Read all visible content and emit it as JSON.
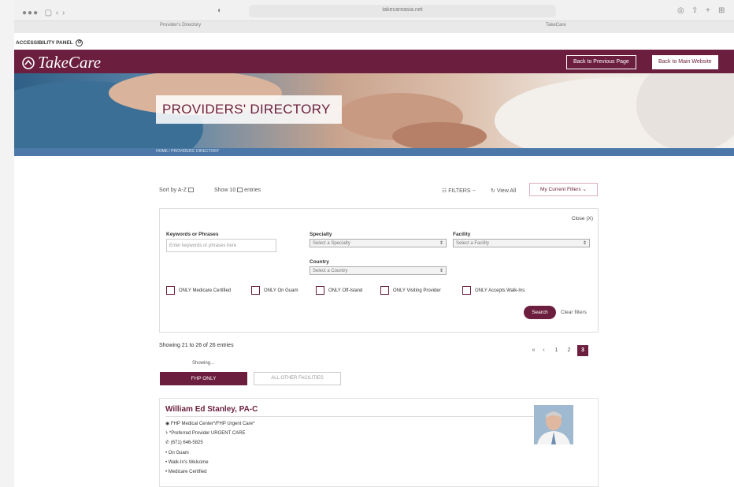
{
  "browser": {
    "url": "takecareasia.net",
    "tabs": [
      "Provider's Directory",
      "TakeCare"
    ]
  },
  "accessibility": {
    "label": "ACCESSIBILITY PANEL"
  },
  "header": {
    "logo_text": "TakeCare",
    "back_previous": "Back to Previous Page",
    "back_main": "Back to Main Website",
    "brand_color": "#6b1e3d"
  },
  "hero": {
    "title": "PROVIDERS' DIRECTORY",
    "breadcrumb": "HOME / PROVIDERS' DIRECTORY"
  },
  "toolbar": {
    "sort_label": "Sort by",
    "sort_value": "A-Z",
    "show_label": "Show",
    "show_value": "10",
    "entries_label": "entries",
    "filters_label": "FILTERS",
    "view_all": "View All",
    "my_filters": "My Current Filters"
  },
  "filters": {
    "close_label": "Close (X)",
    "keywords_label": "Keywords or Phrases",
    "keywords_placeholder": "Enter keywords or phrases here",
    "specialty_label": "Specialty",
    "specialty_value": "Select a Specialty",
    "facility_label": "Facility",
    "facility_value": "Select a Facility",
    "country_label": "Country",
    "country_value": "Select a Country",
    "checkboxes": [
      "ONLY Medicare Certified",
      "ONLY On Guam",
      "ONLY Off-Island",
      "ONLY Visiting Provider",
      "ONLY Accepts Walk-Ins"
    ],
    "search_label": "Search",
    "clear_label": "Clear filters"
  },
  "results": {
    "summary": "Showing 21 to 26 of 26 entries",
    "sub": "Showing...",
    "pagination": [
      "«",
      "‹",
      "1",
      "2",
      "3"
    ],
    "tab_active": "FHP ONLY",
    "tab_inactive": "ALL OTHER FACILITIES"
  },
  "provider": {
    "name": "William Ed Stanley, PA-C",
    "facility": "FHP Medical Center*/FHP Urgent Care*",
    "specialty": "*Preferred Provider URGENT CARE",
    "phone": "(671) 646-5825",
    "tags": [
      "On Guam",
      "Walk-In's Welcome",
      "Medicare Certified"
    ]
  }
}
